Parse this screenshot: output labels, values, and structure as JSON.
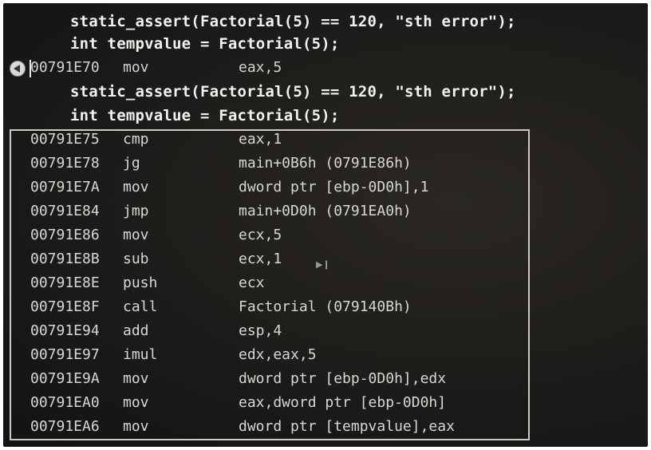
{
  "source_lines": [
    "static_assert(Factorial(5) == 120, \"sth error\");",
    "int tempvalue = Factorial(5);",
    "static_assert(Factorial(5) == 120, \"sth error\");",
    "int tempvalue = Factorial(5);"
  ],
  "current_instruction": {
    "addr": "00791E70",
    "op": "mov",
    "args": "eax,5"
  },
  "instructions": [
    {
      "addr": "00791E75",
      "op": "cmp",
      "args": "eax,1"
    },
    {
      "addr": "00791E78",
      "op": "jg",
      "args": "main+0B6h (0791E86h)"
    },
    {
      "addr": "00791E7A",
      "op": "mov",
      "args": "dword ptr [ebp-0D0h],1"
    },
    {
      "addr": "00791E84",
      "op": "jmp",
      "args": "main+0D0h (0791EA0h)"
    },
    {
      "addr": "00791E86",
      "op": "mov",
      "args": "ecx,5"
    },
    {
      "addr": "00791E8B",
      "op": "sub",
      "args": "ecx,1"
    },
    {
      "addr": "00791E8E",
      "op": "push",
      "args": "ecx"
    },
    {
      "addr": "00791E8F",
      "op": "call",
      "args": "Factorial (079140Bh)"
    },
    {
      "addr": "00791E94",
      "op": "add",
      "args": "esp,4"
    },
    {
      "addr": "00791E97",
      "op": "imul",
      "args": "edx,eax,5"
    },
    {
      "addr": "00791E9A",
      "op": "mov",
      "args": "dword ptr [ebp-0D0h],edx"
    },
    {
      "addr": "00791EA0",
      "op": "mov",
      "args": "eax,dword ptr [ebp-0D0h]"
    },
    {
      "addr": "00791EA6",
      "op": "mov",
      "args": "dword ptr [tempvalue],eax"
    }
  ],
  "icons": {
    "breakpoint": "current-statement-arrow-icon",
    "step": "run-to-click-icon"
  },
  "colors": {
    "background": "#1d1b19",
    "source_text": "#f2f2ee",
    "asm_text": "#d9d7d2",
    "highlight_border": "#cfcac0"
  }
}
